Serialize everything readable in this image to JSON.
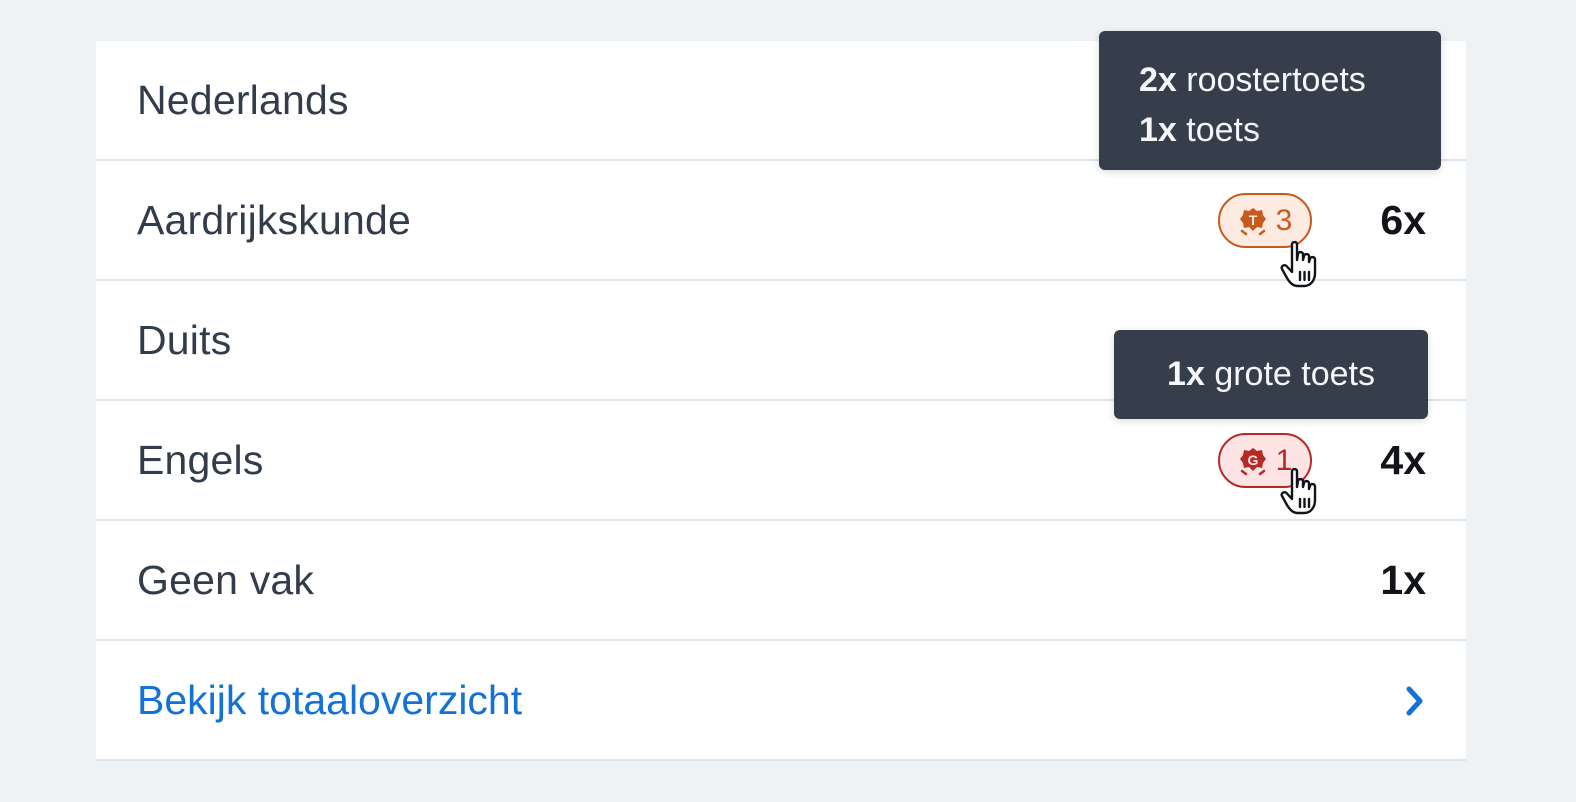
{
  "rows": [
    {
      "subject": "Nederlands",
      "count": ""
    },
    {
      "subject": "Aardrijkskunde",
      "count": "6x",
      "badge": {
        "icon": "roostertoets-shield-icon",
        "letter": "T",
        "value": "3",
        "color": "#c65a1f"
      }
    },
    {
      "subject": "Duits",
      "count": ""
    },
    {
      "subject": "Engels",
      "count": "4x",
      "badge": {
        "icon": "grote-toets-shield-icon",
        "letter": "G",
        "value": "1",
        "color": "#b52a25"
      }
    },
    {
      "subject": "Geen vak",
      "count": "1x"
    }
  ],
  "footer": {
    "link_label": "Bekijk totaaloverzicht",
    "chevron_icon": "chevron-right-icon",
    "link_color": "#1472d6"
  },
  "tooltips": {
    "aardrijkskunde": [
      {
        "count": "2x",
        "label": "roostertoets"
      },
      {
        "count": "1x",
        "label": "toets"
      }
    ],
    "engels": [
      {
        "count": "1x",
        "label": "grote toets"
      }
    ]
  },
  "cursor_icon": "hand-pointer-icon"
}
